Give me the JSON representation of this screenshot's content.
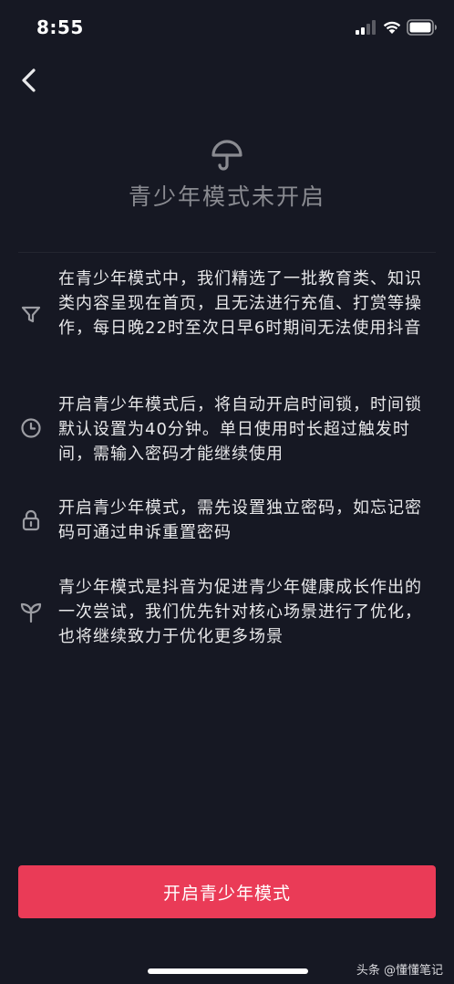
{
  "status_bar": {
    "time": "8:55"
  },
  "header": {
    "title": "青少年模式未开启"
  },
  "features": [
    {
      "icon": "filter-icon",
      "text": "在青少年模式中，我们精选了一批教育类、知识类内容呈现在首页，且无法进行充值、打赏等操作，每日晚22时至次日早6时期间无法使用抖音"
    },
    {
      "icon": "clock-icon",
      "text": "开启青少年模式后，将自动开启时间锁，时间锁默认设置为40分钟。单日使用时长超过触发时间，需输入密码才能继续使用"
    },
    {
      "icon": "lock-icon",
      "text": "开启青少年模式，需先设置独立密码，如忘记密码可通过申诉重置密码"
    },
    {
      "icon": "sprout-icon",
      "text": "青少年模式是抖音为促进青少年健康成长作出的一次尝试，我们优先针对核心场景进行了优化，也将继续致力于优化更多场景"
    }
  ],
  "actions": {
    "enable_label": "开启青少年模式"
  },
  "watermark": "头条 @懂懂笔记",
  "colors": {
    "background": "#161823",
    "accent": "#ea3b57",
    "title": "#8a8b91",
    "text": "#e8e8ea"
  }
}
